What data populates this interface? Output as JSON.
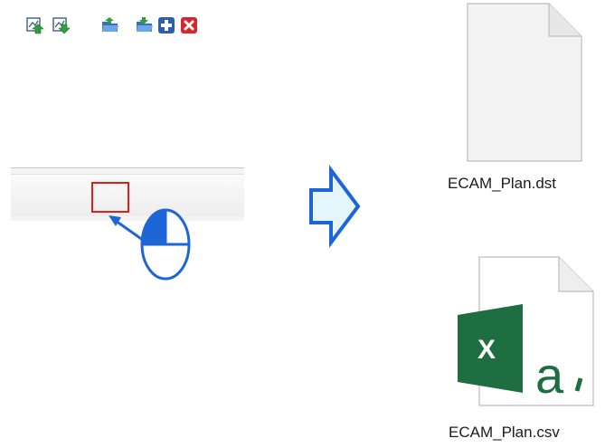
{
  "toolbar": {
    "buttons": [
      {
        "name": "upload-button",
        "icon": "chart-upload-icon"
      },
      {
        "name": "download-button",
        "icon": "chart-download-icon"
      },
      {
        "name": "open-button",
        "icon": "open-folder-icon",
        "highlighted": true
      },
      {
        "name": "save-button",
        "icon": "save-folder-icon"
      },
      {
        "name": "add-button",
        "icon": "plus-icon"
      },
      {
        "name": "delete-button",
        "icon": "close-icon"
      }
    ]
  },
  "pointer": {
    "icon": "mouse-left-click-icon"
  },
  "transition": {
    "icon": "right-arrow-icon"
  },
  "files": [
    {
      "name": "ECAM_Plan.dst",
      "icon": "blank-file-icon"
    },
    {
      "name": "ECAM_Plan.csv",
      "icon": "excel-csv-file-icon"
    }
  ],
  "colors": {
    "highlight": "#e0201a",
    "arrow": "#1e66d6",
    "excel": "#1e6e42"
  }
}
